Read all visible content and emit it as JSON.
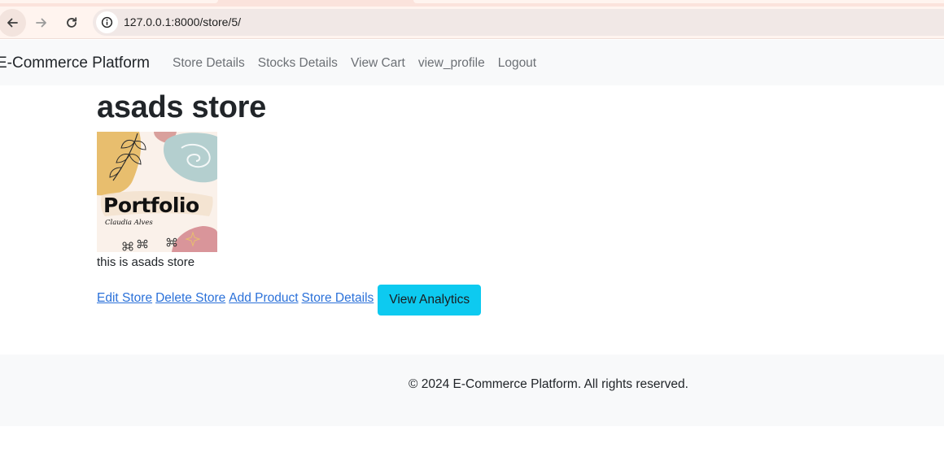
{
  "browser": {
    "url": "127.0.0.1:8000/store/5/"
  },
  "navbar": {
    "brand": "E-Commerce Platform",
    "links": [
      {
        "label": "Store Details"
      },
      {
        "label": "Stocks Details"
      },
      {
        "label": "View Cart"
      },
      {
        "label": "view_profile"
      },
      {
        "label": "Logout"
      }
    ]
  },
  "store": {
    "name": "asads store",
    "image": {
      "title": "Portfolio",
      "subtitle": "Claudia Alves"
    },
    "description": "this is asads store",
    "actions": {
      "edit": "Edit Store",
      "delete": "Delete Store",
      "add_product": "Add Product",
      "details": "Store Details",
      "analytics": "View Analytics"
    }
  },
  "footer": {
    "text": "© 2024 E-Commerce Platform. All rights reserved."
  },
  "colors": {
    "link": "#2b71d9",
    "info_button": "#0dcaf0",
    "navbar_bg": "#f8f9fa",
    "chrome_bg": "#fff4ef"
  }
}
